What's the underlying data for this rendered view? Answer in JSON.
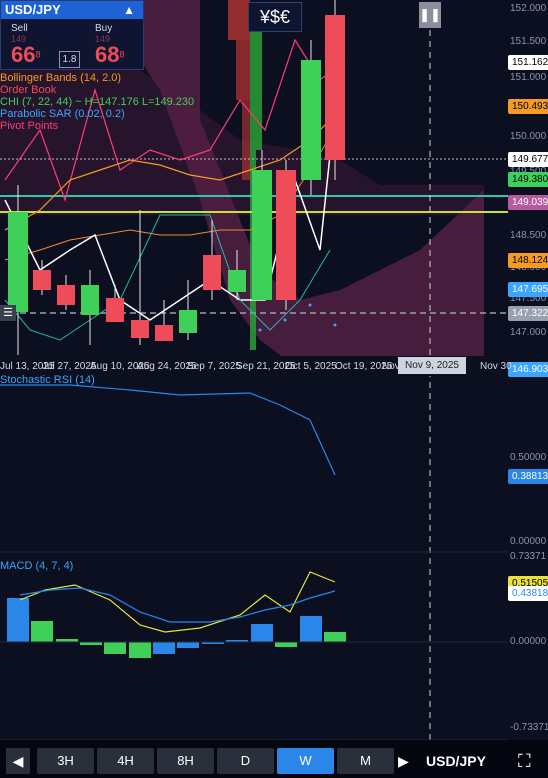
{
  "ticket": {
    "symbol": "USD/JPY",
    "sell_label": "Sell",
    "sell_small": "149",
    "sell_big": "66",
    "sell_sup": "8",
    "buy_label": "Buy",
    "buy_small": "149",
    "buy_big": "68",
    "buy_sup": "8",
    "spread": "1.8"
  },
  "indicators": [
    {
      "label": "Bollinger Bands (14, 2.0)",
      "color": "#f59a23"
    },
    {
      "label": "Order Book",
      "color": "#ef4c5a"
    },
    {
      "label": "CHI (7, 22, 44) ~ H=147.176 L=149.230",
      "color": "#3fd05a"
    },
    {
      "label": "Parabolic SAR (0.02, 0.2)",
      "color": "#3aa6ff"
    },
    {
      "label": "Pivot Points",
      "color": "#ff3c78"
    }
  ],
  "symbol_badge": "¥$€",
  "price_axis": [
    "152.000",
    "151.500",
    "151.000",
    "150.500",
    "150.000",
    "149.500",
    "149.000",
    "148.500",
    "148.000",
    "147.500",
    "147.000"
  ],
  "price_tags": [
    {
      "value": "151.162",
      "color": "#ffffff"
    },
    {
      "value": "150.493",
      "color": "#f59a23"
    },
    {
      "value": "149.677",
      "color": "#ffffff"
    },
    {
      "value": "149.380",
      "color": "#3fd05a"
    },
    {
      "value": "149.039",
      "color": "#b85aa0"
    },
    {
      "value": "148.124",
      "color": "#f59a23"
    },
    {
      "value": "147.695",
      "color": "#3aa6ff"
    },
    {
      "value": "147.322",
      "color": "#9aa0ad"
    },
    {
      "value": "146.903",
      "color": "#3aa6ff"
    }
  ],
  "dates": [
    "Jul 13, 2025",
    "Jul 27, 2025",
    "Aug 10, 2025",
    "Aug 24, 2025",
    "Sep 7, 2025",
    "Sep 21, 2025",
    "Oct 5, 2025",
    "Oct 19, 2025",
    "Nov 2, 2025",
    "Nov 9, 2025",
    "Nov 30"
  ],
  "crosshair_date": "Nov 9, 2025",
  "stoch": {
    "label": "Stochastic RSI (14)",
    "axis": [
      "0.50000",
      "0.00000"
    ],
    "tag": "0.38813"
  },
  "macd": {
    "label": "MACD (4, 7, 4)",
    "axis": [
      "0.73371",
      "0.00000",
      "-0.73371"
    ],
    "tags": [
      "0.51505",
      "0.43818"
    ]
  },
  "timeframes": [
    "3H",
    "4H",
    "8H",
    "D",
    "W",
    "M"
  ],
  "active_timeframe": "W",
  "pair": "USD/JPY",
  "colors": {
    "bull": "#3fd05a",
    "bear": "#ef4c5a",
    "accent": "#2a86e8"
  }
}
